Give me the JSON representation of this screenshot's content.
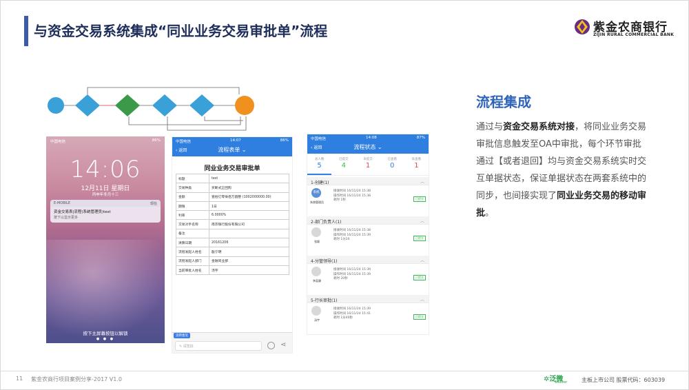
{
  "header": {
    "title": "与资金交易系统集成“同业业务交易审批单”流程",
    "logo_cn": "紫金农商银行",
    "logo_en": "ZIJIN RURAL COMMERCIAL BANK",
    "accent": "#3b5aa8"
  },
  "lock_screen": {
    "carrier": "中国电信",
    "battery": "86%",
    "time": "14:06",
    "date": "12月11日 星期日",
    "lunar": "丙申年冬月十三",
    "notif_app": "E-MOBILE",
    "notif_when": "现在",
    "notif_title": "资金交易表|流程(系统管理员)test",
    "notif_sub": "按下以显示更多",
    "unlock_hint": "按下主屏幕按钮以解锁",
    "dots": "● ● ●"
  },
  "form_screen": {
    "carrier": "中国电信",
    "clock": "14:07",
    "battery": "86%",
    "back": "返回",
    "title": "流程表单",
    "form_title": "同业业务交易审批单",
    "rows": [
      {
        "k": "标题",
        "v": "test"
      },
      {
        "k": "交易种类",
        "v": "买断式正回购"
      },
      {
        "k": "金额",
        "v": "壹拾亿零柒佰万圆整 (1002000000.00)"
      },
      {
        "k": "期限",
        "v": "1日"
      },
      {
        "k": "利率",
        "v": "6.0000%"
      },
      {
        "k": "交易对手名称",
        "v": "南京银行股份有限公司"
      },
      {
        "k": "备注",
        "v": ""
      },
      {
        "k": "清算日期",
        "v": "20161206"
      },
      {
        "k": "流程发起人姓名",
        "v": "殷宁明"
      },
      {
        "k": "流程发起人部门",
        "v": "金融同业部"
      },
      {
        "k": "当前审批人姓名",
        "v": "汤宇"
      }
    ],
    "tag": "流转意见",
    "input_placeholder": "请签批"
  },
  "status_screen": {
    "carrier": "中国电信",
    "clock": "14:08",
    "battery": "87%",
    "back": "返回",
    "title": "流程状态",
    "stats": [
      {
        "label": "总人数",
        "value": "5",
        "color": "#2f7fe0"
      },
      {
        "label": "已提交",
        "value": "4",
        "color": "#3cba54"
      },
      {
        "label": "未提交",
        "value": "1",
        "color": "#e0454a"
      },
      {
        "label": "已查看",
        "value": "0",
        "color": "#2f7fe0"
      },
      {
        "label": "未查看",
        "value": "1",
        "color": "#e0454a"
      }
    ],
    "nodes": [
      {
        "section": "1-创建(1)",
        "name": "系统管理员",
        "avatar": "系统",
        "t1": "接收时间    16/11/24  15:38",
        "t2": "操作时间    16/11/24  15:38",
        "t3": "耗时    1秒",
        "badge": "已提交"
      },
      {
        "section": "2-部门负责人(1)",
        "name": "张颖",
        "avatar": "",
        "t1": "接收时间    16/11/24  15:38",
        "t2": "操作时间    16/11/24  15:39",
        "t3": "耗时    1分20",
        "badge": "已提交"
      },
      {
        "section": "4-分管领导(1)",
        "name": "李茹康",
        "avatar": "",
        "t1": "接收时间    16/11/24  15:39",
        "t2": "操作时间    16/11/24  15:39",
        "t3": "耗时    20秒",
        "badge": "已提交"
      },
      {
        "section": "5-行长审批(1)",
        "name": "汤宇",
        "avatar": "",
        "t1": "接收时间    16/11/24  15:39",
        "t2": "操作时间    16/11/24  15:41",
        "t3": "耗时    1分40秒",
        "badge": "已提交"
      }
    ]
  },
  "right": {
    "heading": "流程集成",
    "p1": "通过与",
    "b1": "资金交易系统对接",
    "p2": "，将同业业务交易审批信息触发至OA中审批，每个环节审批通过【或者退回】均与资金交易系统实时交互单据状态，保证单据状态在两套系统中的同步，也间接实现了",
    "b2": "同业业务交易的移动审批",
    "p3": "。"
  },
  "footer": {
    "page": "11",
    "text": "紫金农商行项目案例分享-2017 V1.0",
    "logo": "泛微",
    "logo_en": "weaver",
    "right": "主板上市公司   股票代码：603039"
  }
}
